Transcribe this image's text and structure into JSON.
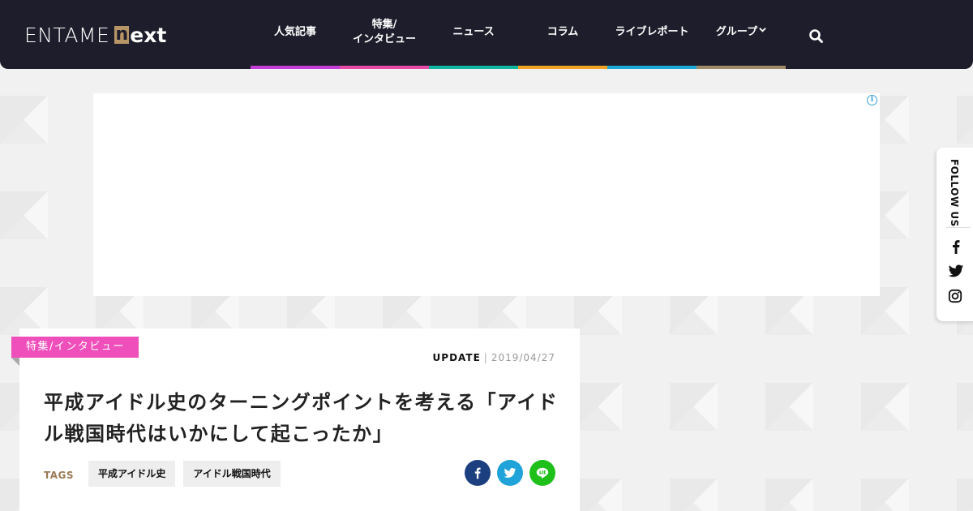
{
  "brand": {
    "logo_main": "ENTAME",
    "logo_n": "n",
    "logo_ext": "ext"
  },
  "nav": {
    "items": [
      {
        "label": "人気記事",
        "color": "#c33ed6"
      },
      {
        "label": "特集/\nインタビュー",
        "color": "#e84aa8"
      },
      {
        "label": "ニュース",
        "color": "#12b5a0"
      },
      {
        "label": "コラム",
        "color": "#f0a224"
      },
      {
        "label": "ライブレポート",
        "color": "#1aa9d6"
      },
      {
        "label": "グループ",
        "color": "#a08a6a"
      }
    ],
    "search_icon": "search-icon"
  },
  "ad": {
    "info_glyph": "i"
  },
  "follow": {
    "label": "FOLLOW US",
    "icons": [
      "facebook-icon",
      "twitter-icon",
      "instagram-icon"
    ]
  },
  "article": {
    "category": "特集/インタビュー",
    "update_label": "UPDATE",
    "update_sep": "|",
    "update_date": "2019/04/27",
    "title": "平成アイドル史のターニングポイントを考える「アイドル戦国時代はいかにして起こったか」",
    "tags_label": "TAGS",
    "tags": [
      "平成アイドル史",
      "アイドル戦国時代"
    ],
    "share": [
      {
        "icon": "facebook-icon",
        "color": "#1c3f80"
      },
      {
        "icon": "twitter-icon",
        "color": "#1fa3d8"
      },
      {
        "icon": "line-icon",
        "color": "#1fc01a"
      }
    ]
  }
}
